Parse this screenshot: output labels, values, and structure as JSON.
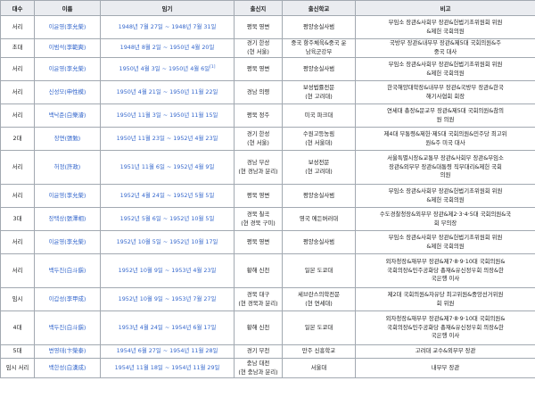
{
  "headers": [
    "대수",
    "이름",
    "임기",
    "출신지",
    "출신학교",
    "비고"
  ],
  "rows": [
    {
      "order": "서리",
      "name": "이윤영(李允榮)",
      "term": "1948년 7월 27일 ~ 1948년 7월 31일",
      "term_note": "",
      "origin": "평북 영변",
      "school": "평양숭실사범",
      "note": "무임소 장관&사회부 장관&헌법기초위원회 위원\n&제헌 국회의원"
    },
    {
      "order": "초대",
      "name": "이범석(李範奭)",
      "term": "1948년 8월 2일 ~ 1950년 4월 20일",
      "term_note": "",
      "origin": "경기 한성\n(현 서울)",
      "school": "중국 항주체육&중국 운\n남육군강무",
      "note": "국방부 장관&내무부 장관&제5대 국회의원&주\n중국 대사"
    },
    {
      "order": "서리",
      "name": "이윤영(李允榮)",
      "term": "1950년 4월 3일 ~ 1950년 4월 6일",
      "term_note": "[1]",
      "origin": "평북 영변",
      "school": "평양숭실사범",
      "note": "무임소 장관&사회부 장관&헌법기초위원회 위원\n&제헌 국회의원"
    },
    {
      "order": "서리",
      "name": "신성모(申性模)",
      "term": "1950년 4월 21일 ~ 1950년 11월 22일",
      "term_note": "",
      "origin": "경남 의령",
      "school": "보성법률전문\n(현 고려대)",
      "note": "한국해양대학장&내무부 장관&국방부 장관&한국\n해기사협회 회장"
    },
    {
      "order": "서리",
      "name": "백낙준(白樂濬)",
      "term": "1950년 11월 3일 ~ 1950년 11월 15일",
      "term_note": "",
      "origin": "평북 정주",
      "school": "미국 파크대",
      "note": "연세대 총장&문교부 장관&제5대 국회의원&참의\n원 의원"
    },
    {
      "order": "2대",
      "name": "장면(張勉)",
      "term": "1950년 11월 23일 ~ 1952년 4월 23일",
      "term_note": "",
      "origin": "경기 한성\n(현 서울)",
      "school": "수원고등농림\n(현 서울대)",
      "note": "제4대 부통령&제헌·제5대 국회의원&민주당 최고위\n원&주 미국 대사"
    },
    {
      "order": "서리",
      "name": "허정(許政)",
      "term": "1951년 11월 6일 ~ 1952년 4월 9일",
      "term_note": "",
      "origin": "경남 부산\n(현 경남과 분리)",
      "school": "보성전문\n(현 고려대)",
      "note": "서울특별시장&교통부 장관&사회부 장관&무임소\n장관&외무부 장관&대통령 직무대리&제헌 국회\n의원"
    },
    {
      "order": "서리",
      "name": "이윤영(李允榮)",
      "term": "1952년 4월 24일 ~ 1952년 5월 5일",
      "term_note": "",
      "origin": "평북 영변",
      "school": "평양숭실사범",
      "note": "무임소 장관&사회부 장관&헌법기초위원회 위원\n&제헌 국회의원"
    },
    {
      "order": "3대",
      "name": "장택상(張澤相)",
      "term": "1952년 5월 6일 ~ 1952년 10월 5일",
      "term_note": "",
      "origin": "경북 칠곡\n(현 경북 구미)",
      "school": "영국 에든버러대",
      "note": "수도경찰청장&외무부 장관&제2·3·4·5대 국회의원&국\n회 부의장"
    },
    {
      "order": "서리",
      "name": "이윤영(李允榮)",
      "term": "1952년 10월 5일 ~ 1952년 10월 17일",
      "term_note": "",
      "origin": "평북 영변",
      "school": "평양숭실사범",
      "note": "무임소 장관&사회부 장관&헌법기초위원회 위원\n&제헌 국회의원"
    },
    {
      "order": "서리",
      "name": "백두진(白斗鎭)",
      "term": "1952년 10월 9일 ~ 1953년 4월 23일",
      "term_note": "",
      "origin": "황해 신천",
      "school": "일본 도쿄대",
      "note": "외자청장&재무부 장관&제7·8·9·10대 국회의원&\n국회의장&민주공화당 총재&유신정우회 의장&한\n국은행 이사"
    },
    {
      "order": "임시",
      "name": "이갑성(李甲成)",
      "term": "1952년 10월 9일 ~ 1953년 7월 27일",
      "term_note": "",
      "origin": "경북 대구\n(현 경북과 분리)",
      "school": "세브란스의학전문\n(현 연세대)",
      "note": "제2대 국회의원&자유당 최고위원&중앙선거위원\n회 위원"
    },
    {
      "order": "4대",
      "name": "백두진(白斗鎭)",
      "term": "1953년 4월 24일 ~ 1954년 6월 17일",
      "term_note": "",
      "origin": "황해 신천",
      "school": "일본 도쿄대",
      "note": "외자청장&재무부 장관&제7·8·9·10대 국회의원&\n국회의장&민주공화당 총재&유신정우회 의장&한\n국은행 이사"
    },
    {
      "order": "5대",
      "name": "변영태(卞榮泰)",
      "term": "1954년 6월 27일 ~ 1954년 11월 28일",
      "term_note": "",
      "origin": "경기 부천",
      "school": "만주 신흥학교",
      "note": "고려대 교수&외무부 장관"
    },
    {
      "order": "임시 서리",
      "name": "백한성(白漢成)",
      "term": "1954년 11월 18일 ~ 1954년 11월 29일",
      "term_note": "",
      "origin": "충남 대전\n(현 충남과 분리)",
      "school": "서울대",
      "note": "내무부 장관"
    }
  ]
}
